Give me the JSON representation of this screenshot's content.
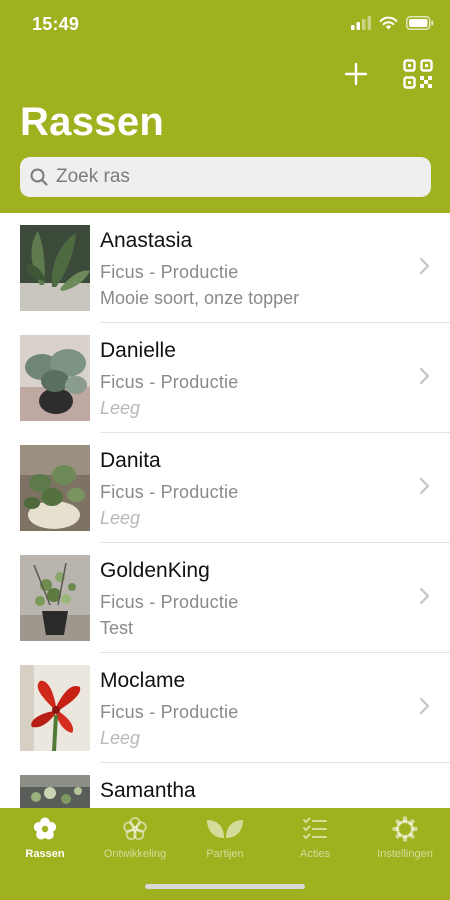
{
  "status_bar": {
    "time": "15:49",
    "battery_icon": "battery-icon",
    "wifi_icon": "wifi-icon",
    "signal_icon": "signal-icon"
  },
  "nav": {
    "add_icon": "plus-icon",
    "qr_icon": "qr-code-icon"
  },
  "page": {
    "title": "Rassen"
  },
  "search": {
    "placeholder": "Zoek ras",
    "value": ""
  },
  "colors": {
    "accent": "#9fb11f",
    "background": "#ffffff",
    "search_bg": "#efefef",
    "empty_note": "#b8b8bc"
  },
  "list": {
    "items": [
      {
        "name": "Anastasia",
        "type": "Ficus - Productie",
        "note": "Mooie soort, onze topper",
        "note_empty": false
      },
      {
        "name": "Danielle",
        "type": "Ficus - Productie",
        "note": "Leeg",
        "note_empty": true
      },
      {
        "name": "Danita",
        "type": "Ficus - Productie",
        "note": "Leeg",
        "note_empty": true
      },
      {
        "name": "GoldenKing",
        "type": "Ficus - Productie",
        "note": "Test",
        "note_empty": false
      },
      {
        "name": "Moclame",
        "type": "Ficus - Productie",
        "note": "Leeg",
        "note_empty": true
      },
      {
        "name": "Samantha",
        "type": "",
        "note": "",
        "note_empty": false
      }
    ]
  },
  "tabbar": {
    "tabs": [
      {
        "label": "Rassen",
        "icon": "flower-icon",
        "active": true
      },
      {
        "label": "Ontwikkeling",
        "icon": "flower-outline-icon",
        "active": false
      },
      {
        "label": "Partijen",
        "icon": "leaves-icon",
        "active": false
      },
      {
        "label": "Acties",
        "icon": "checklist-icon",
        "active": false
      },
      {
        "label": "Instellingen",
        "icon": "gear-icon",
        "active": false
      }
    ]
  }
}
